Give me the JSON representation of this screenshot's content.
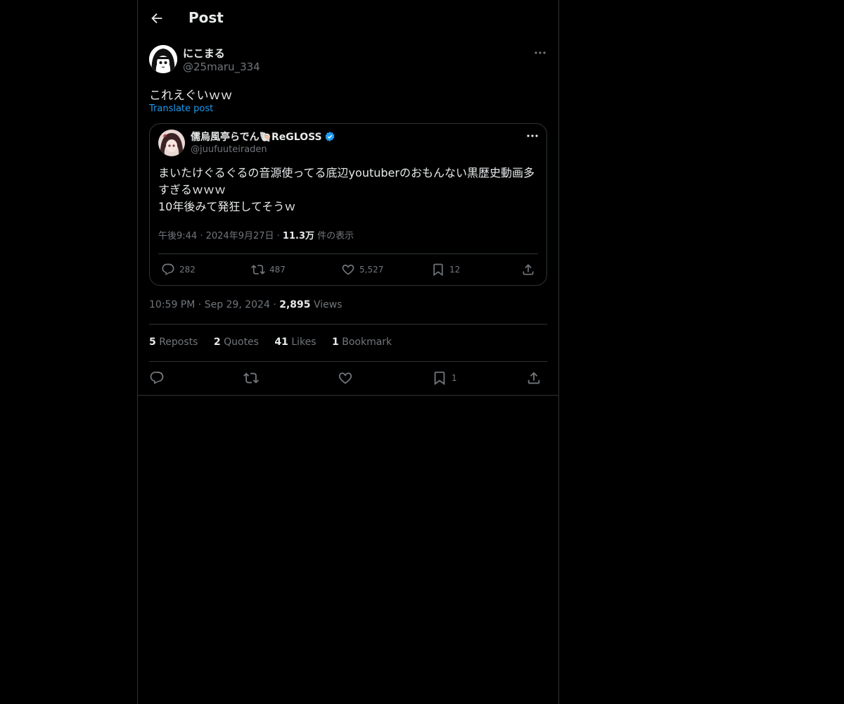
{
  "header": {
    "title": "Post"
  },
  "post": {
    "author_name": "にこまる",
    "author_handle": "@25maru_334",
    "text": "これえぐいｗｗ",
    "translate_label": "Translate post",
    "time": "10:59 PM",
    "date": "Sep 29, 2024",
    "views_count": "2,895",
    "views_label": "Views",
    "stats": {
      "reposts_count": "5",
      "reposts_label": "Reposts",
      "quotes_count": "2",
      "quotes_label": "Quotes",
      "likes_count": "41",
      "likes_label": "Likes",
      "bookmarks_count": "1",
      "bookmarks_label": "Bookmark"
    },
    "actions": {
      "bookmark_count": "1"
    }
  },
  "quote": {
    "author_name": "儒烏風亭らでん🐚ReGLOSS",
    "author_handle": "@juufuuteiraden",
    "text_line1": "まいたけぐるぐるの音源使ってる底辺youtuberのおもんない黒歴史動画多",
    "text_line2": "すぎるｗｗｗ",
    "text_line3": "10年後みて発狂してそうｗ",
    "time": "午後9:44",
    "date": "2024年9月27日",
    "views_count": "11.3万",
    "views_label": "件の表示",
    "replies": "282",
    "reposts": "487",
    "likes": "5,527",
    "bookmarks": "12"
  },
  "colors": {
    "background": "#000000",
    "text": "#e7e9ea",
    "muted": "#71767b",
    "link": "#1d9bf0",
    "border": "#2f3336",
    "verified": "#1d9bf0"
  }
}
